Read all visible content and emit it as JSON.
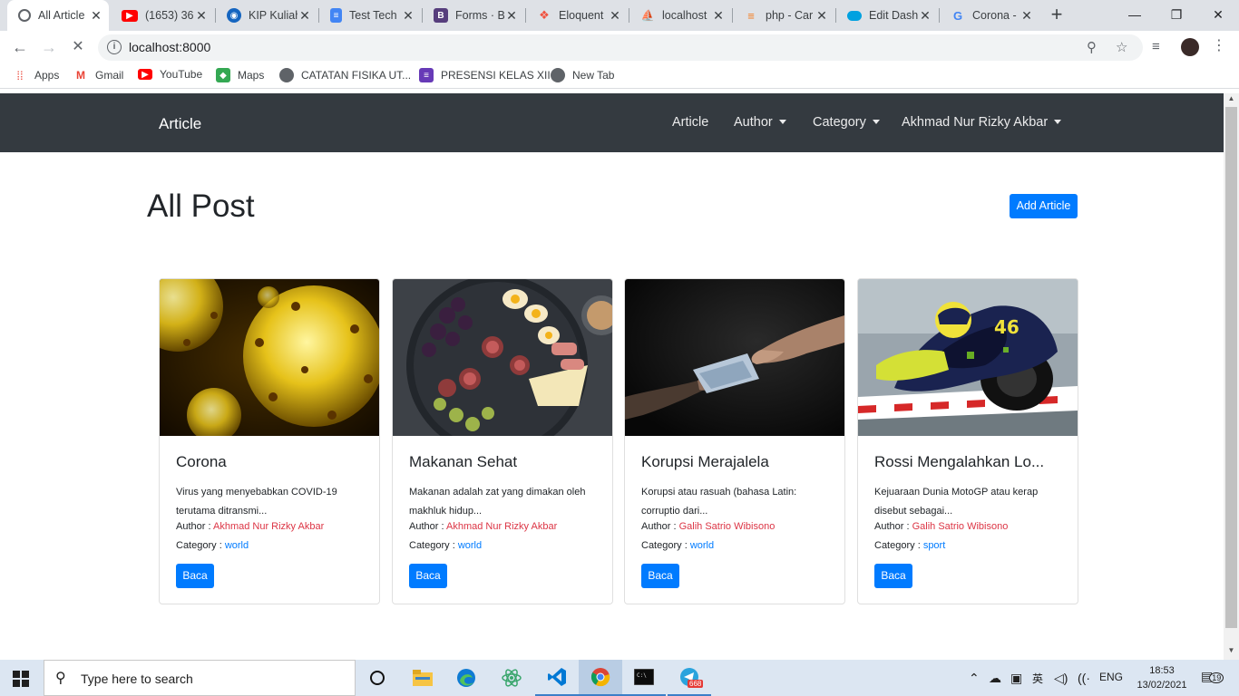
{
  "browser": {
    "tabs": [
      {
        "title": "All Article",
        "icon": "globe-icon",
        "color": "#5f6368"
      },
      {
        "title": "(1653) 36",
        "icon": "youtube-icon",
        "color": "#ff0000"
      },
      {
        "title": "KIP Kuliah",
        "icon": "kip-icon",
        "color": "#1565c0"
      },
      {
        "title": "Test Tech",
        "icon": "docs-icon",
        "color": "#4285f4"
      },
      {
        "title": "Forms · B",
        "icon": "bootstrap-icon",
        "color": "#563d7c"
      },
      {
        "title": "Eloquent",
        "icon": "laravel-icon",
        "color": "#f05340"
      },
      {
        "title": "localhost",
        "icon": "phpmyadmin-icon",
        "color": "#f29111"
      },
      {
        "title": "php - Car",
        "icon": "stackoverflow-icon",
        "color": "#f48024"
      },
      {
        "title": "Edit Dash",
        "icon": "salesforce-icon",
        "color": "#00a1e0"
      },
      {
        "title": "Corona -",
        "icon": "google-icon",
        "color": "#4285f4"
      }
    ],
    "new_tab": "+",
    "url": "localhost:8000",
    "bookmarks": [
      {
        "label": "Apps",
        "icon": "apps-grid-icon"
      },
      {
        "label": "Gmail",
        "icon": "gmail-icon"
      },
      {
        "label": "YouTube",
        "icon": "youtube-icon"
      },
      {
        "label": "Maps",
        "icon": "maps-icon"
      },
      {
        "label": "CATATAN FISIKA UT...",
        "icon": "globe-icon"
      },
      {
        "label": "PRESENSI KELAS XII",
        "icon": "forms-icon"
      },
      {
        "label": "New Tab",
        "icon": "globe-icon"
      }
    ]
  },
  "app": {
    "brand": "Article",
    "nav": {
      "article": "Article",
      "author": "Author",
      "category": "Category",
      "user": "Akhmad Nur Rizky Akbar"
    },
    "heading": "All Post",
    "add_button": "Add Article",
    "labels": {
      "author": "Author : ",
      "category": "Category : "
    },
    "read_button": "Baca",
    "posts": [
      {
        "title": "Corona",
        "excerpt_1": "Virus yang menyebabkan COVID-19",
        "excerpt_2": "terutama ditransmi...",
        "author": "Akhmad Nur Rizky Akbar",
        "category": "world",
        "image": "virus-image"
      },
      {
        "title": "Makanan Sehat",
        "excerpt_1": "Makanan adalah zat yang dimakan oleh",
        "excerpt_2": "makhluk hidup...",
        "author": "Akhmad Nur Rizky Akbar",
        "category": "world",
        "image": "food-platter-image"
      },
      {
        "title": "Korupsi Merajalela",
        "excerpt_1": "Korupsi atau rasuah (bahasa Latin:",
        "excerpt_2": "corruptio dari...",
        "author": "Galih Satrio Wibisono",
        "category": "world",
        "image": "bribe-money-image"
      },
      {
        "title": "Rossi Mengalahkan Lo...",
        "excerpt_1": "Kejuaraan Dunia MotoGP atau kerap",
        "excerpt_2": "disebut sebagai...",
        "author": "Galih Satrio Wibisono",
        "category": "sport",
        "image": "motogp-rider-image"
      }
    ]
  },
  "taskbar": {
    "search_placeholder": "Type here to search",
    "lang": "ENG",
    "time": "18:53",
    "date": "13/02/2021",
    "notif_count": "19",
    "telegram_badge": "668"
  },
  "colors": {
    "navbar": "#343a40",
    "primary": "#007bff",
    "author_link": "#dc3545"
  }
}
